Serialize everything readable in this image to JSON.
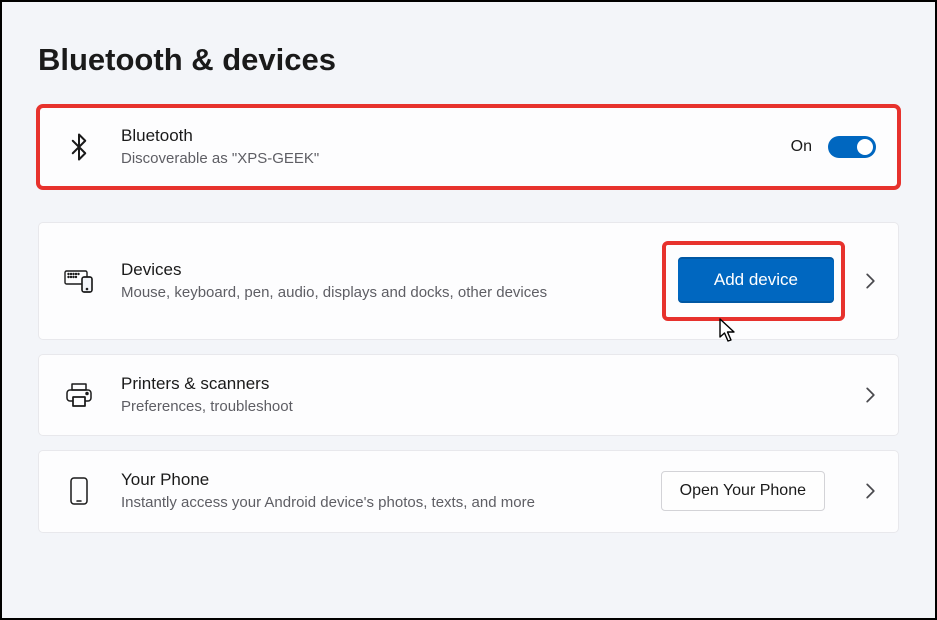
{
  "page": {
    "title": "Bluetooth & devices"
  },
  "bluetooth": {
    "title": "Bluetooth",
    "subtitle": "Discoverable as \"XPS-GEEK\"",
    "state_label": "On"
  },
  "devices": {
    "title": "Devices",
    "subtitle": "Mouse, keyboard, pen, audio, displays and docks, other devices",
    "action_label": "Add device"
  },
  "printers": {
    "title": "Printers & scanners",
    "subtitle": "Preferences, troubleshoot"
  },
  "phone": {
    "title": "Your Phone",
    "subtitle": "Instantly access your Android device's photos, texts, and more",
    "action_label": "Open Your Phone"
  }
}
